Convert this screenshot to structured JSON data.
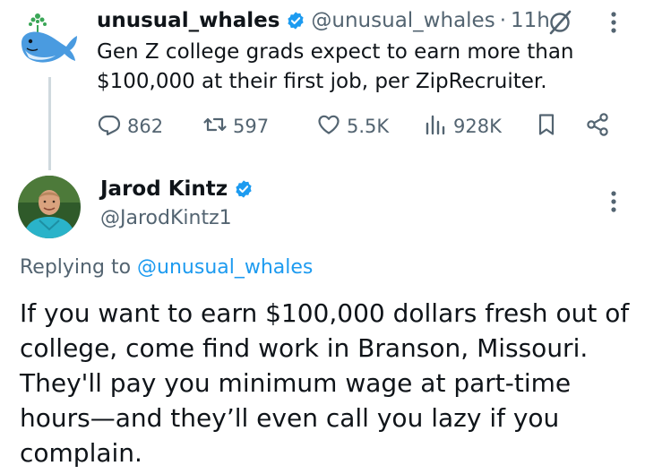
{
  "parent": {
    "avatar_icon": "whale-avatar-icon",
    "name": "unusual_whales",
    "handle": "@unusual_whales",
    "separator": "·",
    "time": "11h",
    "text": "Gen Z college grads expect to earn more than $100,000 at their first job, per ZipRecruiter.",
    "stats": {
      "replies": "862",
      "reposts": "597",
      "likes": "5.5K",
      "views": "928K"
    }
  },
  "reply": {
    "name": "Jarod Kintz",
    "handle": "@JarodKintz1",
    "replying_prefix": "Replying to",
    "replying_to": "@unusual_whales",
    "text": "If you want to earn $100,000 dollars fresh out of college, come find work in Branson, Missouri. They'll pay you minimum wage at part-time hours—and they’ll even call you lazy if you complain."
  },
  "colors": {
    "verified": "#1d9bf0",
    "link": "#1d9bf0",
    "muted": "#536471",
    "text": "#0f1419"
  }
}
